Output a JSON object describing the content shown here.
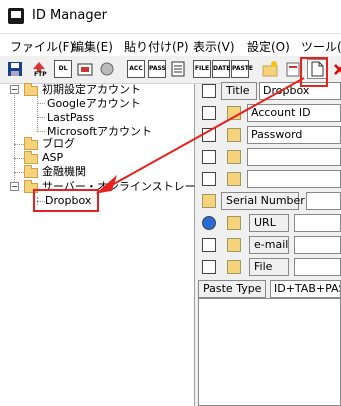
{
  "window": {
    "title": "ID Manager"
  },
  "menu": [
    "ファイル(F)",
    "編集(E)",
    "貼り付け(P)",
    "表示(V)",
    "設定(O)",
    "ツール(T"
  ],
  "toolbar": {
    "buttons": [
      "save",
      "FTP",
      "DOWNLOAD",
      "SAVE-DATA",
      "LINK",
      "ACC",
      "PASS",
      "ENTRY",
      "FILE",
      "DATE",
      "PASTE",
      "FOLDER",
      "NEW",
      "DELETE"
    ],
    "labels": {
      "ftp": "FTP",
      "dl": "DL",
      "acc": "ACC",
      "pass": "PASS",
      "file": "FILE",
      "date": "DATE",
      "paste": "PASTE"
    }
  },
  "tree": {
    "root1": "初期設定アカウント",
    "root1_children": [
      "Googleアカウント",
      "LastPass",
      "Microsoftアカウント"
    ],
    "blog": "ブログ",
    "asp": "ASP",
    "finance": "金融機関",
    "server": "サーバー・オンラインストレー",
    "server_child": "Dropbox"
  },
  "fields": {
    "title_label": "Title",
    "title_value": "Dropbox",
    "account_id": "Account ID",
    "password": "Password",
    "serial_label": "Serial Number",
    "url_label": "URL",
    "email_label": "e-mail",
    "file_label": "File",
    "paste_type_label": "Paste Type",
    "paste_type_value": "ID+TAB+PAS"
  },
  "colors": {
    "accent_red": "#e8201e",
    "folder": "#f6d37a"
  }
}
